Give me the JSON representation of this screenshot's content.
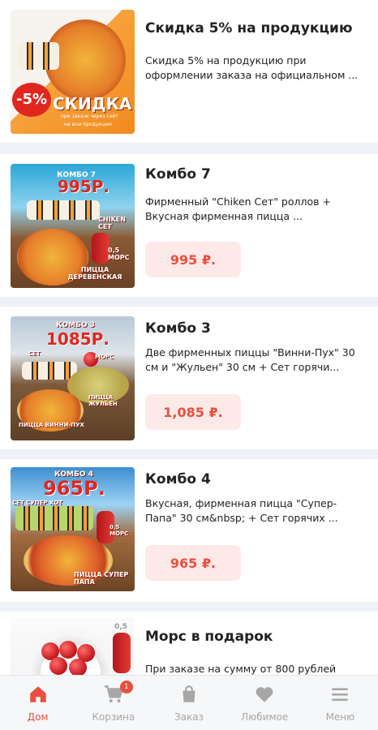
{
  "products": [
    {
      "title": "Скидка 5% на продукцию",
      "description": "Скидка 5% на продукцию при оформлении заказа на официальном ...",
      "price": "",
      "image_text": [
        "-5%",
        "СКИДКА",
        "при заказе через сайт",
        "на всю продукцию"
      ]
    },
    {
      "title": "Комбо 7",
      "description": "Фирменный \"Chiken Сет\" роллов + Вкусная фирменная пицца ...",
      "price": "995 ₽.",
      "image_text": [
        "КОМБО 7",
        "995Р.",
        "CHIKEN СЕТ",
        "0,5 МОРС",
        "ПИЦЦА ДЕРЕВЕНСКАЯ"
      ]
    },
    {
      "title": "Комбо 3",
      "description": "Две фирменных пиццы \"Винни-Пух\" 30 см и \"Жульен\" 30 см + Сет горячи...",
      "price": "1,085 ₽.",
      "image_text": [
        "КОМБО 3",
        "1085Р.",
        "СЕТ",
        "МОРС",
        "ПИЦЦА ВИННИ-ПУХ",
        "ПИЦЦА ЖУЛЬЕН"
      ]
    },
    {
      "title": "Комбо 4",
      "description": "Вкусная, фирменная пицца \"Супер-Папа\" 30 см&nbsp; + Сет горячих ...",
      "price": "965 ₽.",
      "image_text": [
        "КОМБО 4",
        "965Р.",
        "СЕТ СУПЕР ХОТ",
        "0,5 МОРС",
        "ПИЦЦА СУПЕР ПАПА"
      ]
    },
    {
      "title": "Морс в подарок",
      "description": "При заказе на сумму от 800 рублей",
      "price": "",
      "image_text": [
        "0,5"
      ]
    }
  ],
  "tabs": [
    {
      "label": "Дом",
      "icon": "home-icon",
      "active": true
    },
    {
      "label": "Корзина",
      "icon": "cart-icon",
      "badge": "1"
    },
    {
      "label": "Заказ",
      "icon": "bag-icon"
    },
    {
      "label": "Любимое",
      "icon": "heart-icon"
    },
    {
      "label": "Меню",
      "icon": "menu-icon"
    }
  ],
  "colors": {
    "accent": "#e8503f",
    "price_bg": "#fde9e7",
    "inactive": "#a7a7a7"
  }
}
